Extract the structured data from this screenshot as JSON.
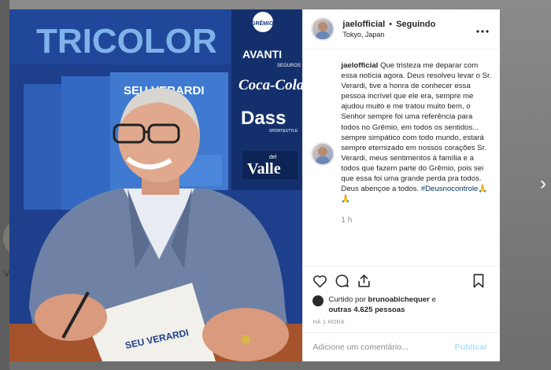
{
  "post": {
    "username": "jaelofficial",
    "separator": "•",
    "follow_status": "Seguindo",
    "location": "Tokyo, Japan",
    "more_icon": "more-horizontal-icon"
  },
  "photo": {
    "banner_word": "TRICOLOR",
    "book_title": "SEU VERARDI",
    "book_spine": "SEU VERARDI",
    "sponsors": [
      "GRÊMIO",
      "AVANTI",
      "SEGUROS",
      "Coca-Cola",
      "Dass",
      "SPORT&STYLE",
      "del",
      "Valle"
    ],
    "colors": {
      "backdrop": "#1d3f8c",
      "backdrop_dark": "#123172",
      "suit": "#6f82a6",
      "shirt": "#e9ecf3"
    }
  },
  "caption": {
    "username": "jaelofficial",
    "text": "Que tristeza me deparar com essa notícia agora. Deus resolveu levar o Sr. Verardi, tive a honra de conhecer essa pessoa incrível que ele era, sempre me ajudou muito e me tratou muito bem, o Senhor sempre foi uma referência para todos no Grêmio, em todos os sentidos... sempre simpático com todo mundo, estará sempre eternizado em nossos corações Sr. Verardi, meus sentimentos à família e a todos que fazem parte do Grêmio, pois sei que essa foi uma grande perda pra todos. Deus abençoe a todos.",
    "hashtag": "#Deusnocontrole🙏🙏",
    "time": "1 h"
  },
  "actions": {
    "like_icon": "heart-icon",
    "comment_icon": "comment-icon",
    "share_icon": "share-icon",
    "save_icon": "bookmark-icon"
  },
  "likes": {
    "prefix": "Curtido por",
    "user": "brunoabichequer",
    "connector": "e",
    "others": "outras 4.625 pessoas"
  },
  "posted_ago": "HÁ 1 HORA",
  "comment": {
    "placeholder": "Adicione um comentário...",
    "publish_label": "Publicar"
  },
  "navigation": {
    "next_icon": "chevron-right-icon",
    "next_glyph": "›"
  },
  "background": {
    "partial_letter": "V"
  }
}
